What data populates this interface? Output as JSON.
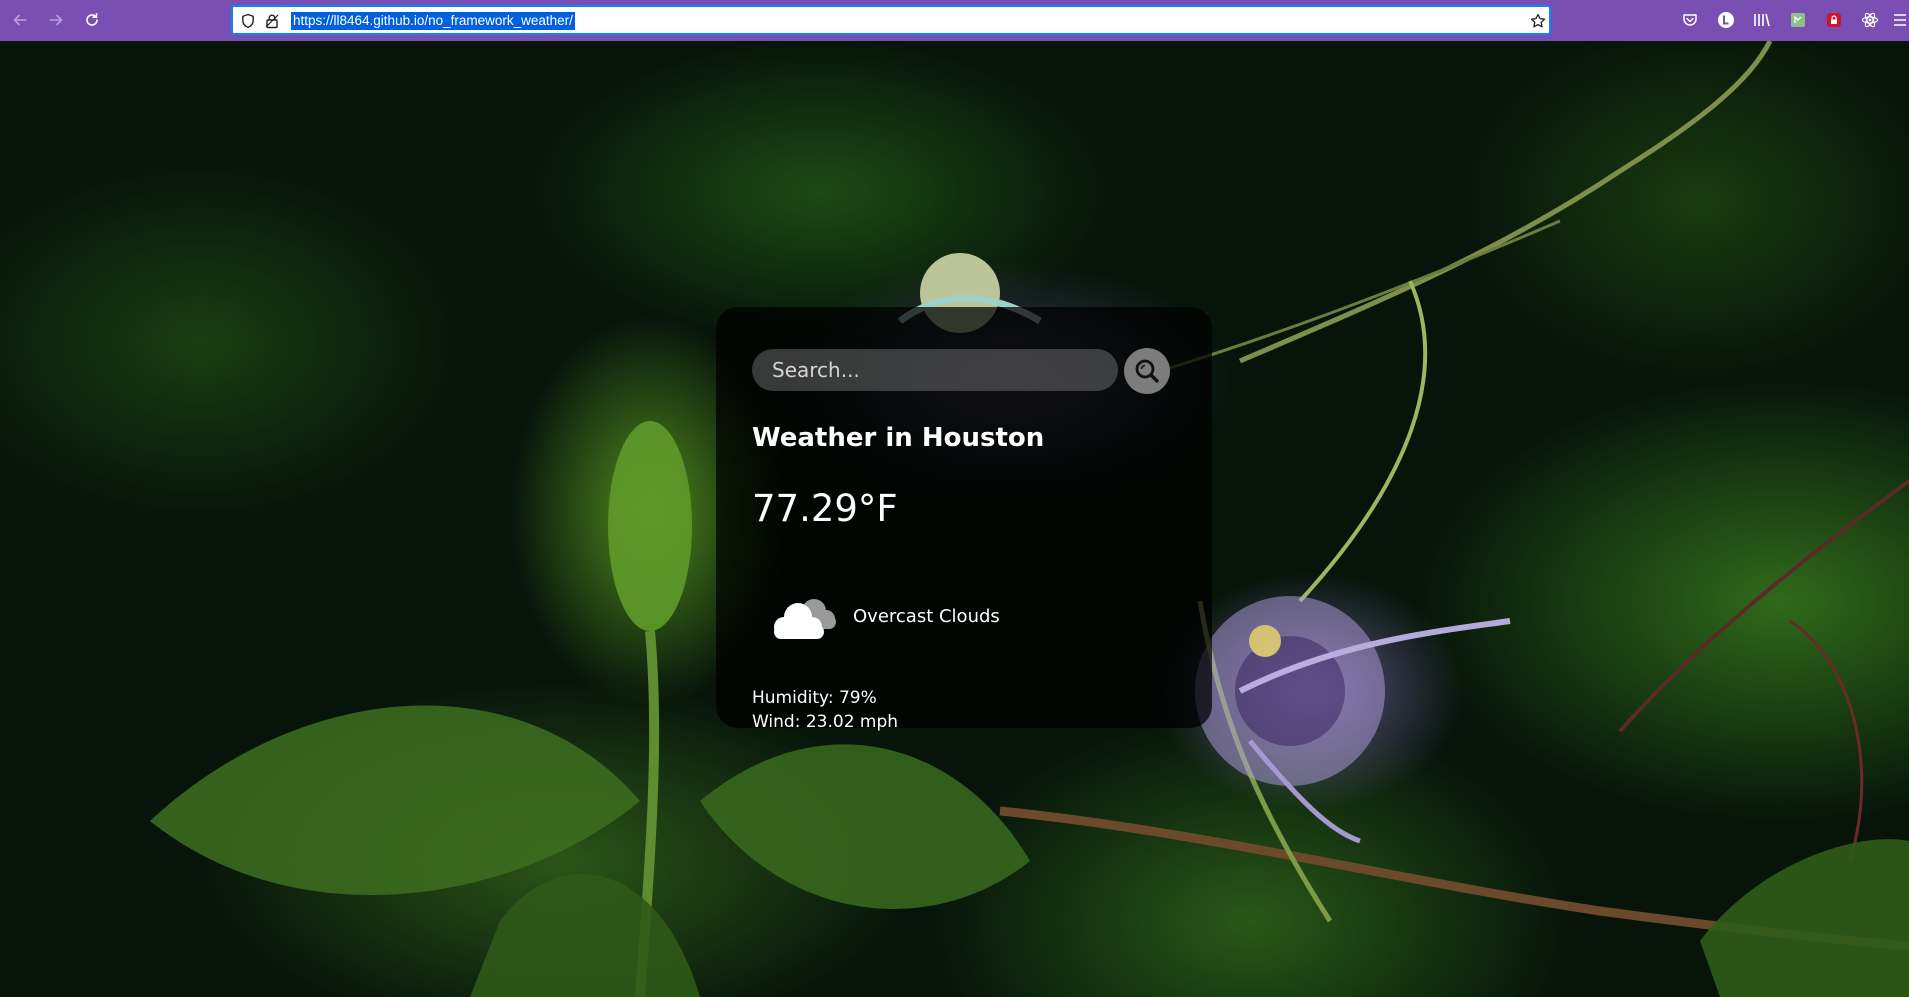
{
  "browser": {
    "url": "https://ll8464.github.io/no_framework_weather/",
    "toolbar_icons": [
      "back-arrow-icon",
      "forward-arrow-icon",
      "reload-icon",
      "shield-icon",
      "lock-icon",
      "star-icon",
      "pocket-icon",
      "account-icon",
      "library-icon",
      "extension-icon",
      "addon-lock-icon",
      "react-devtools-icon",
      "menu-icon"
    ],
    "accent_color": "#7a4fb4",
    "url_highlight_color": "#0060df"
  },
  "weather": {
    "search_placeholder": "Search...",
    "title": "Weather in Houston",
    "temperature": "77.29°F",
    "description": "Overcast Clouds",
    "humidity": "Humidity: 79%",
    "wind": "Wind: 23.02 mph",
    "icon": "overcast-clouds-icon",
    "search_icon": "search-icon"
  }
}
